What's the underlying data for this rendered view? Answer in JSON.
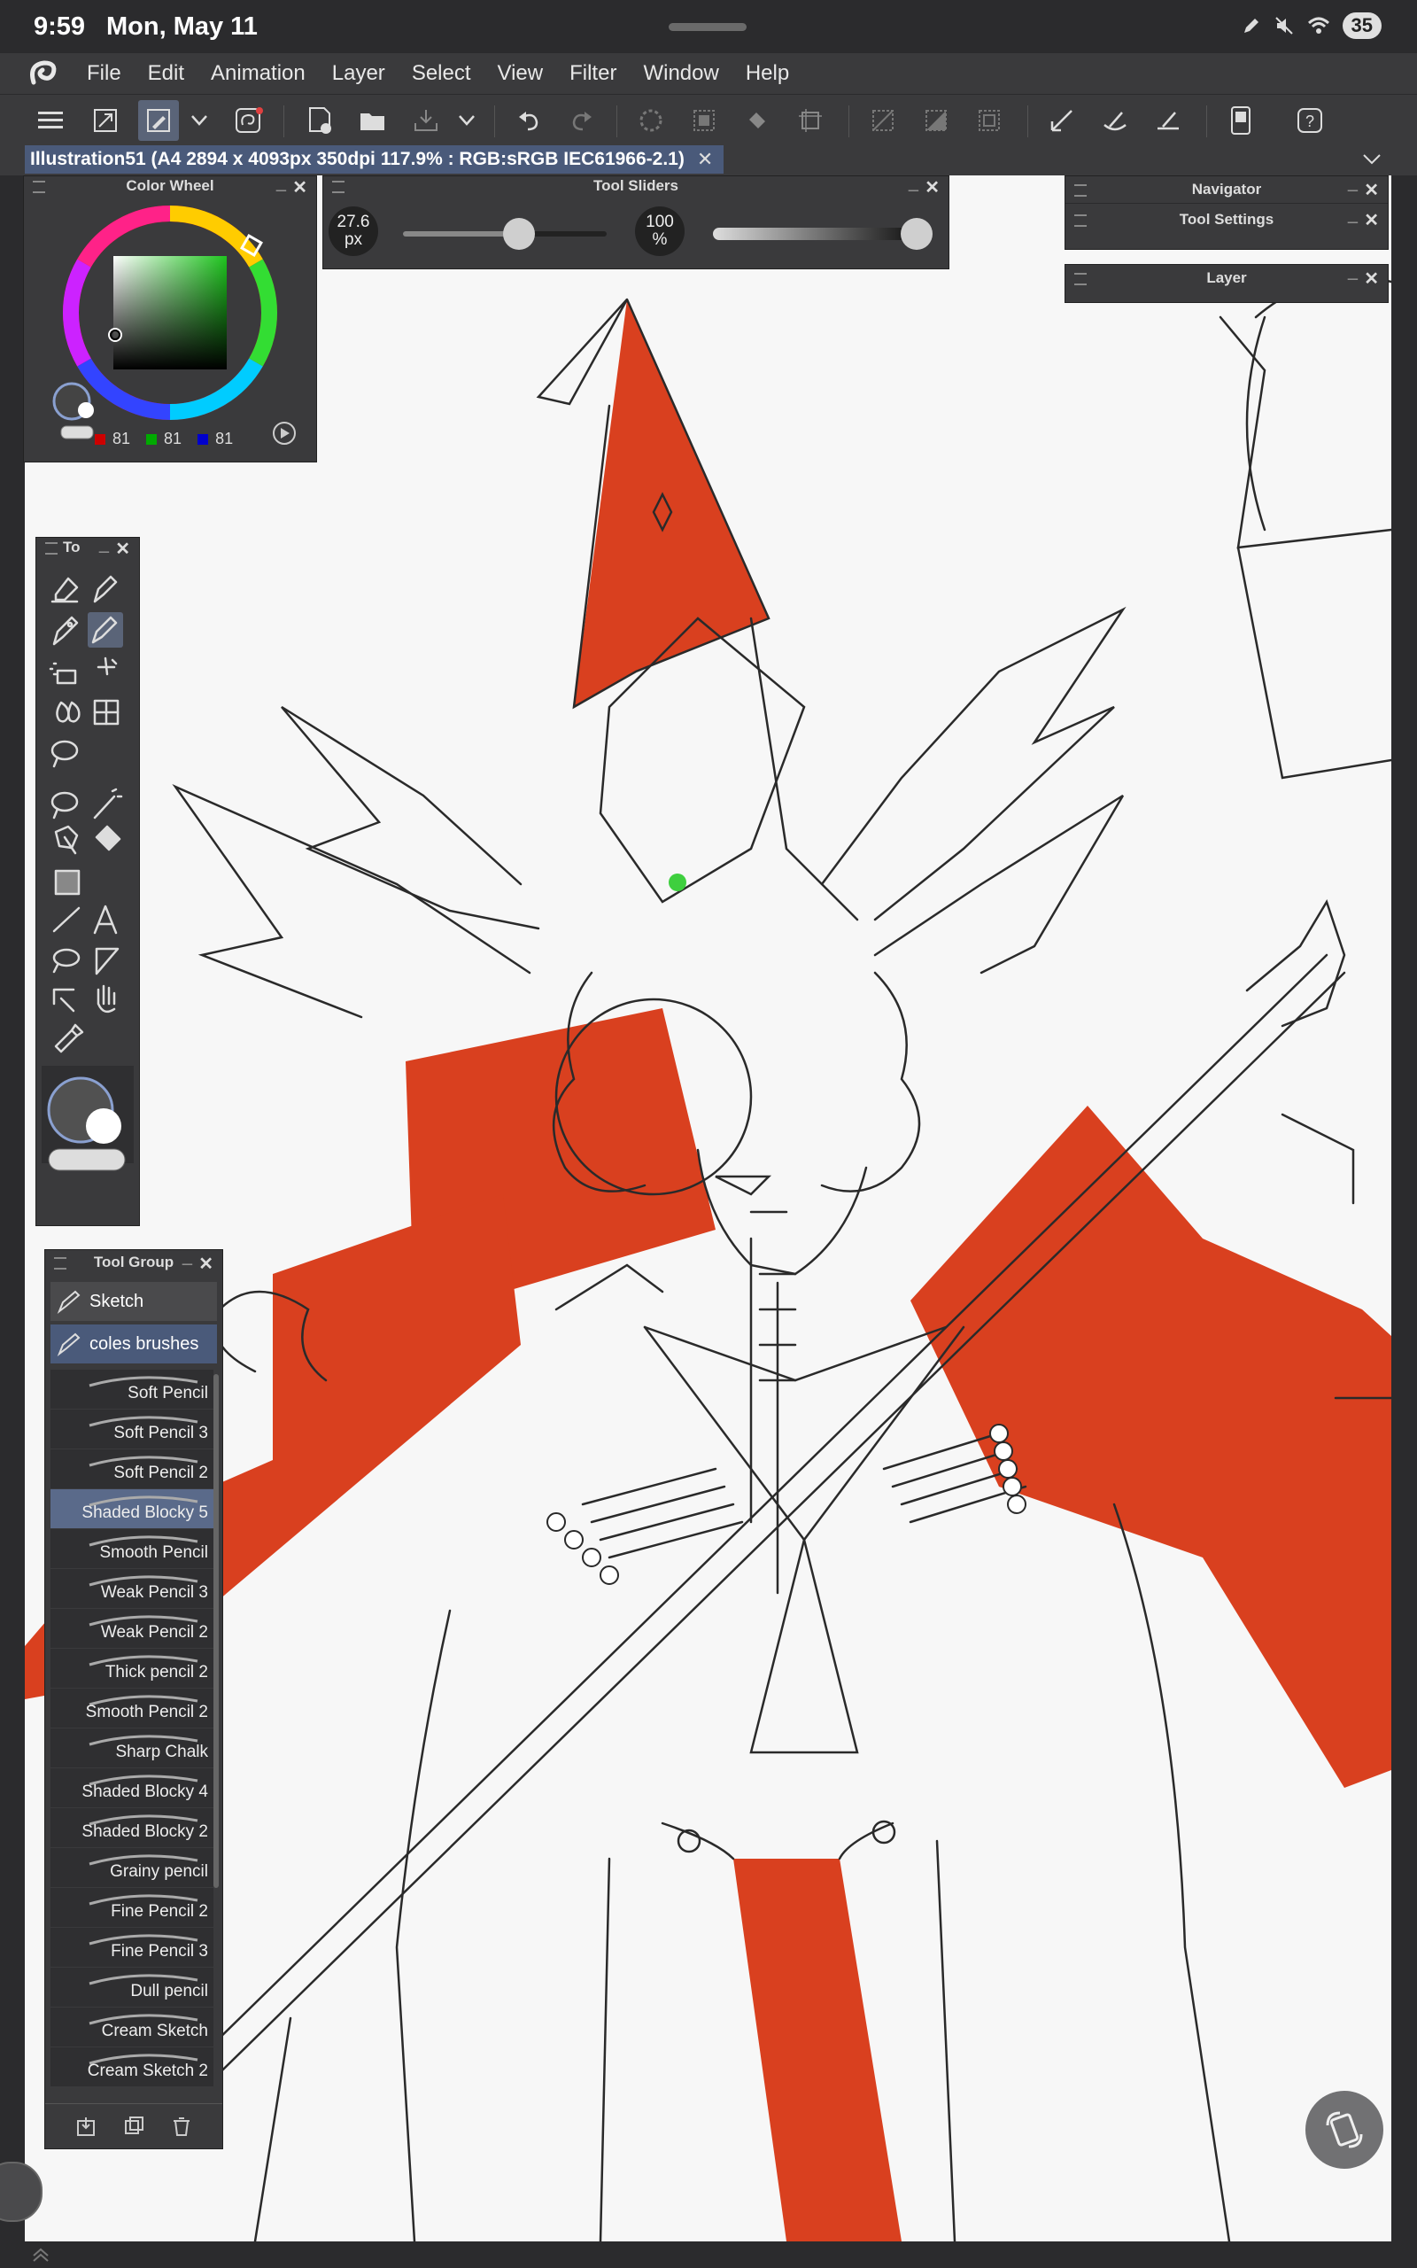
{
  "status_bar": {
    "time": "9:59",
    "date": "Mon, May 11",
    "battery": "35"
  },
  "menu": {
    "items": [
      "File",
      "Edit",
      "Animation",
      "Layer",
      "Select",
      "View",
      "Filter",
      "Window",
      "Help"
    ]
  },
  "document_tab": {
    "title": "Illustration51 (A4 2894 x 4093px 350dpi 117.9% : RGB:sRGB IEC61966-2.1)",
    "close": "✕"
  },
  "color_wheel": {
    "title": "Color Wheel",
    "r": "81",
    "g": "81",
    "b": "81"
  },
  "tool_sliders": {
    "title": "Tool Sliders",
    "size_value": "27.6",
    "size_unit": "px",
    "opacity_value": "100",
    "opacity_unit": "%",
    "size_fraction": 0.57,
    "opacity_fraction": 1.0
  },
  "navigator": {
    "title": "Navigator"
  },
  "tool_settings": {
    "title": "Tool Settings"
  },
  "layer": {
    "title": "Layer"
  },
  "tools_panel": {
    "title": "To"
  },
  "tool_group": {
    "title": "Tool Group",
    "groups": [
      "Sketch",
      "coles brushes"
    ],
    "brushes": [
      "Soft Pencil",
      "Soft Pencil 3",
      "Soft Pencil 2",
      "Shaded Blocky 5",
      "Smooth Pencil",
      "Weak Pencil 3",
      "Weak Pencil 2",
      "Thick pencil 2",
      "Smooth Pencil 2",
      "Sharp Chalk",
      "Shaded Blocky 4",
      "Shaded Blocky 2",
      "Grainy pencil",
      "Fine Pencil 2",
      "Fine Pencil 3",
      "Dull pencil",
      "Cream Sketch",
      "Cream Sketch 2"
    ],
    "selected_brush": "Shaded Blocky 5"
  },
  "colors": {
    "accent": "#5a6478",
    "main_color": "#515151",
    "sub_color": "#ffffff",
    "fill_red": "#d9401f"
  }
}
